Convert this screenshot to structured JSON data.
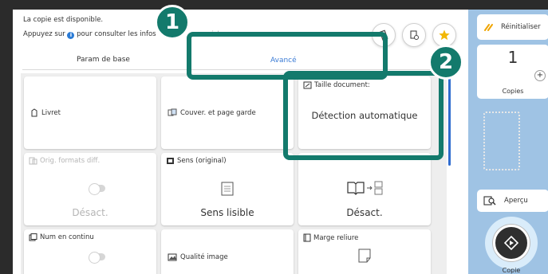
{
  "header": {
    "message_line1": "La copie est disponible.",
    "message_line2_prefix": "Appuyez sur",
    "message_line2_suffix": "pour consulter les infos",
    "message_ghost": "églage:"
  },
  "tabs": [
    {
      "label": "Param de base"
    },
    {
      "label": "Avancé"
    }
  ],
  "cells": {
    "livret": {
      "title": "Livret"
    },
    "couverture": {
      "title": "Couver. et page garde"
    },
    "taille_document": {
      "title": "Taille document:",
      "value": "Détection automatique"
    },
    "orig_formats": {
      "title": "Orig. formats diff.",
      "value": "Désact."
    },
    "sens_original": {
      "title": "Sens (original)",
      "value": "Sens lisible"
    },
    "livre_divise": {
      "value": "Désact."
    },
    "num_continu": {
      "title": "Num en continu"
    },
    "qualite_image": {
      "title": "Qualité image"
    },
    "marge_reliure": {
      "title": "Marge reliure"
    }
  },
  "right_panel": {
    "reset_label": "Réinitialiser",
    "copies_count": "1",
    "plus_symbol": "+",
    "copies_label": "Copies",
    "preview_label": "Aperçu",
    "start_label": "Copie"
  },
  "callouts": [
    {
      "number": "1"
    },
    {
      "number": "2"
    }
  ],
  "colors": {
    "callout": "#137a6c",
    "accent_blue": "#3a7bd5",
    "panel_blue": "#9fc3e4"
  },
  "icons": [
    "info-icon",
    "booklet-icon",
    "cover-icon",
    "doc-size-icon",
    "mixed-sizes-icon",
    "orientation-icon",
    "book-split-icon",
    "numbering-icon",
    "image-quality-icon",
    "binding-margin-icon",
    "reset-icon",
    "preview-icon",
    "start-icon",
    "bookmark-icon",
    "settings-icon",
    "star-icon"
  ]
}
